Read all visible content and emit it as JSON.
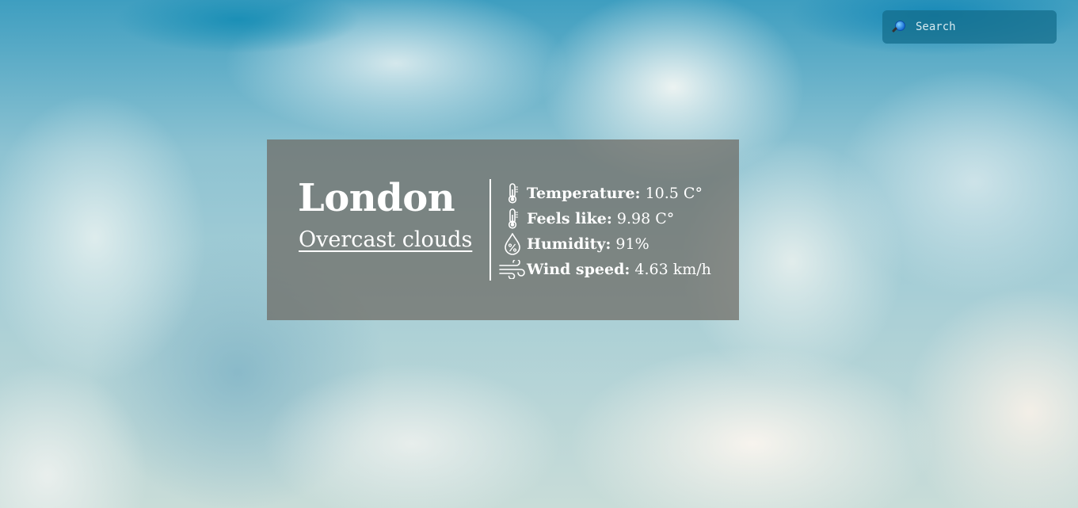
{
  "search": {
    "placeholder": "Search"
  },
  "weather": {
    "city": "London",
    "description": "Overcast clouds",
    "stats": [
      {
        "icon": "thermometer-icon",
        "label": "Temperature:",
        "value": "10.5 C°"
      },
      {
        "icon": "thermometer-icon",
        "label": "Feels like:",
        "value": "9.98 C°"
      },
      {
        "icon": "humidity-drop-icon",
        "label": "Humidity:",
        "value": "91%"
      },
      {
        "icon": "wind-icon",
        "label": "Wind speed:",
        "value": "4.63 km/h"
      }
    ]
  },
  "colors": {
    "card_background": "#6e6962",
    "search_background": "#146e8c",
    "text": "#ffffff"
  }
}
